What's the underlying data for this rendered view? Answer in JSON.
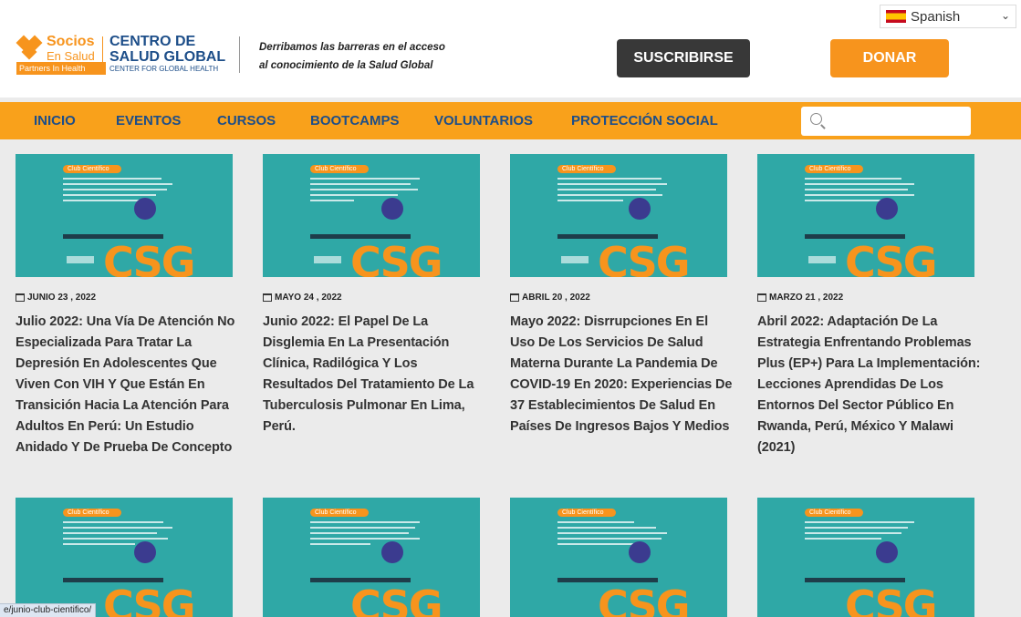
{
  "language": {
    "selected": "Spanish"
  },
  "logo": {
    "socios": "Socios",
    "en_salud": "En Salud",
    "pih": "Partners In Health"
  },
  "org": {
    "line1": "CENTRO DE",
    "line2": "SALUD GLOBAL",
    "line3": "CENTER FOR GLOBAL HEALTH"
  },
  "tagline": {
    "line1": "Derribamos las barreras en el acceso",
    "line2": "al conocimiento de la Salud Global"
  },
  "buttons": {
    "subscribe": "SUSCRIBIRSE",
    "donate": "DONAR"
  },
  "nav": [
    "INICIO",
    "EVENTOS",
    "CURSOS",
    "BOOTCAMPS",
    "VOLUNTARIOS",
    "PROTECCIÓN SOCIAL"
  ],
  "search": {
    "placeholder": ""
  },
  "thumb_text": {
    "pill": "Club Científico",
    "logo": "CSG"
  },
  "posts": [
    {
      "date": "JUNIO 23 , 2022",
      "title": "Julio 2022: Una Vía De Atención No Especializada Para Tratar La Depresión En Adolescentes Que Viven Con VIH Y Que Están En Transición Hacia La Atención Para Adultos En Perú: Un Estudio Anidado Y De Prueba De Concepto"
    },
    {
      "date": "MAYO 24 , 2022",
      "title": "Junio 2022: El Papel De La Disglemia En La Presentación Clínica, Radilógica Y Los Resultados Del Tratamiento De La Tuberculosis Pulmonar En Lima, Perú."
    },
    {
      "date": "ABRIL 20 , 2022",
      "title": "Mayo 2022: Disrrupciones En El Uso De Los Servicios De Salud Materna Durante La Pandemia De COVID-19 En 2020: Experiencias De 37 Establecimientos De Salud En Países De Ingresos Bajos Y Medios"
    },
    {
      "date": "MARZO 21 , 2022",
      "title": "Abril 2022: Adaptación De La Estrategia Enfrentando Problemas Plus (EP+) Para La Implementación: Lecciones Aprendidas De Los Entornos Del Sector Público En Rwanda, Perú, México Y Malawi (2021)"
    }
  ],
  "status_url": "e/junio-club-cientifico/"
}
